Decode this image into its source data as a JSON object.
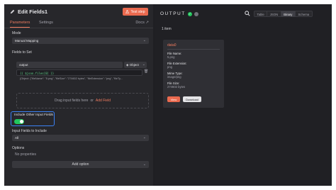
{
  "header": {
    "title": "Edit Fields1",
    "test_step": "Test step",
    "tabs": [
      "Parameters",
      "Settings"
    ],
    "docs": "Docs"
  },
  "params": {
    "mode_label": "Mode",
    "mode_value": "Manual Mapping",
    "fields_label": "Fields to Set",
    "field_name": "output",
    "field_type": "Object",
    "field_value": "{{ $json.files[0] }}",
    "field_result": "{Object: {\"fileName\": \"5.png\", \"fileSize\": \"274602 bytes\", \"fileExtension\": \"png\", \"fileTy...",
    "drop_text": "Drag input fields here",
    "drop_or": "or",
    "add_field": "Add Field",
    "include_label": "Include Other Input Fields",
    "include_on": true,
    "input_fields_label": "Input Fields to Include",
    "input_fields_value": "All",
    "options_label": "Options",
    "no_properties": "No properties",
    "add_option": "Add option"
  },
  "output": {
    "title": "OUTPUT",
    "modes": [
      "Table",
      "JSON",
      "Binary",
      "Schema"
    ],
    "active_mode": "Binary",
    "items_count": "1 item",
    "card": {
      "title": "data0",
      "rows": [
        {
          "key": "File Name:",
          "value": "5.png"
        },
        {
          "key": "File Extension:",
          "value": "png"
        },
        {
          "key": "Mime Type:",
          "value": "image/png"
        },
        {
          "key": "File Size:",
          "value": "274602 bytes"
        }
      ],
      "view": "View",
      "download": "Download"
    }
  },
  "colors": {
    "accent": "#ea6a4f",
    "toggle_on": "#22c55e",
    "highlight": "#3b82f6"
  }
}
